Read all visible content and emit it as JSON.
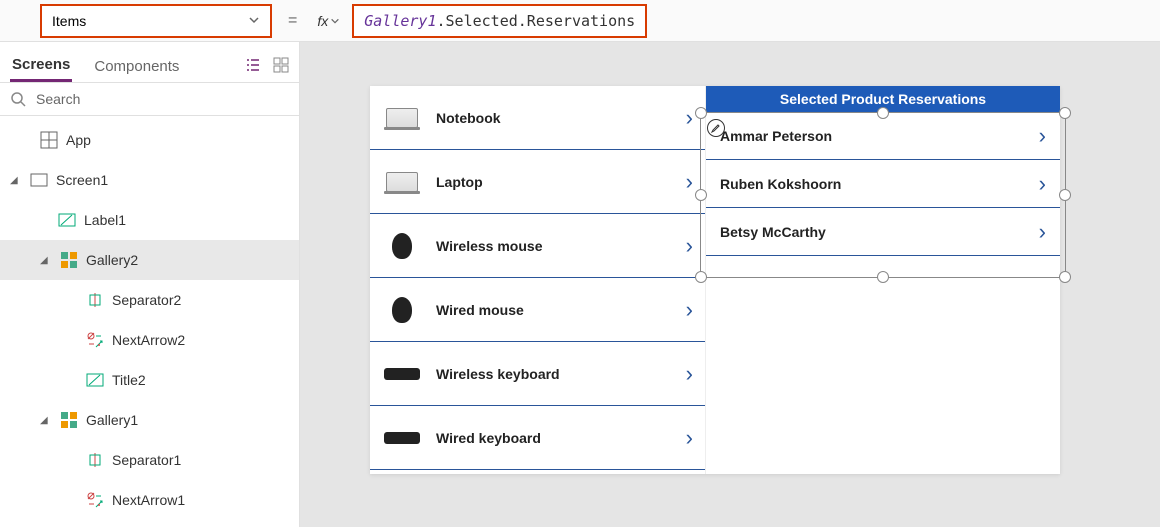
{
  "formulaBar": {
    "property": "Items",
    "fxLabel": "fx",
    "formula_part1": "Gallery1",
    "formula_part2": ".Selected.Reservations"
  },
  "treePanel": {
    "tabs": {
      "screens": "Screens",
      "components": "Components"
    },
    "searchPlaceholder": "Search",
    "items": {
      "app": "App",
      "screen1": "Screen1",
      "label1": "Label1",
      "gallery2": "Gallery2",
      "separator2": "Separator2",
      "nextarrow2": "NextArrow2",
      "title2": "Title2",
      "gallery1": "Gallery1",
      "separator1": "Separator1",
      "nextarrow1": "NextArrow1"
    }
  },
  "gallery1": {
    "items": [
      {
        "label": "Notebook"
      },
      {
        "label": "Laptop"
      },
      {
        "label": "Wireless mouse"
      },
      {
        "label": "Wired mouse"
      },
      {
        "label": "Wireless keyboard"
      },
      {
        "label": "Wired keyboard"
      }
    ]
  },
  "gallery2": {
    "header": "Selected Product Reservations",
    "items": [
      {
        "label": "Ammar Peterson"
      },
      {
        "label": "Ruben Kokshoorn"
      },
      {
        "label": "Betsy McCarthy"
      }
    ]
  }
}
